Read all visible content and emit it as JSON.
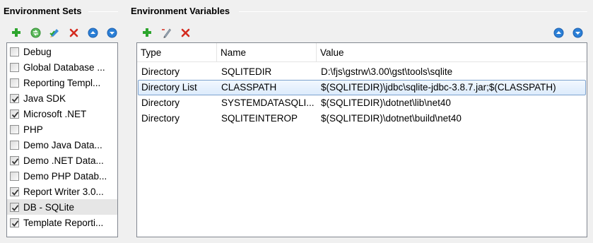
{
  "environment_sets": {
    "title": "Environment Sets",
    "toolbar": [
      {
        "icon": "add-icon",
        "label": ""
      },
      {
        "icon": "copy-icon",
        "label": ""
      },
      {
        "icon": "rename-icon",
        "label": ""
      },
      {
        "icon": "delete-icon",
        "label": ""
      },
      {
        "icon": "move-up-icon",
        "label": ""
      },
      {
        "icon": "move-down-icon",
        "label": ""
      }
    ],
    "items": [
      {
        "label": "Debug",
        "checked": false,
        "selected": false
      },
      {
        "label": "Global Database ...",
        "checked": false,
        "selected": false
      },
      {
        "label": "Reporting Templ...",
        "checked": false,
        "selected": false
      },
      {
        "label": "Java SDK",
        "checked": true,
        "selected": false
      },
      {
        "label": "Microsoft .NET",
        "checked": true,
        "selected": false
      },
      {
        "label": "PHP",
        "checked": false,
        "selected": false
      },
      {
        "label": "Demo Java Data...",
        "checked": false,
        "selected": false
      },
      {
        "label": "Demo .NET Data...",
        "checked": true,
        "selected": false
      },
      {
        "label": "Demo PHP Datab...",
        "checked": false,
        "selected": false
      },
      {
        "label": "Report Writer 3.0...",
        "checked": true,
        "selected": false
      },
      {
        "label": "DB - SQLite",
        "checked": true,
        "selected": true
      },
      {
        "label": "Template Reporti...",
        "checked": true,
        "selected": false
      }
    ]
  },
  "environment_variables": {
    "title": "Environment Variables",
    "columns": [
      "Type",
      "Name",
      "Value"
    ],
    "rows": [
      {
        "type": "Directory",
        "name": "SQLITEDIR",
        "value": "D:\\fjs\\gstrw\\3.00\\gst\\tools\\sqlite",
        "selected": false
      },
      {
        "type": "Directory List",
        "name": "CLASSPATH",
        "value": "$(SQLITEDIR)\\jdbc\\sqlite-jdbc-3.8.7.jar;$(CLASSPATH)",
        "selected": true
      },
      {
        "type": "Directory",
        "name": "SYSTEMDATASQLI...",
        "value": "$(SQLITEDIR)\\dotnet\\lib\\net40",
        "selected": false
      },
      {
        "type": "Directory",
        "name": "SQLITEINTEROP",
        "value": "$(SQLITEDIR)\\dotnet\\build\\net40",
        "selected": false
      }
    ]
  },
  "colors": {
    "add": "#2da52d",
    "delete": "#d42a1e",
    "arrow": "#2b7fd6",
    "selection_border": "#7da2ce"
  }
}
